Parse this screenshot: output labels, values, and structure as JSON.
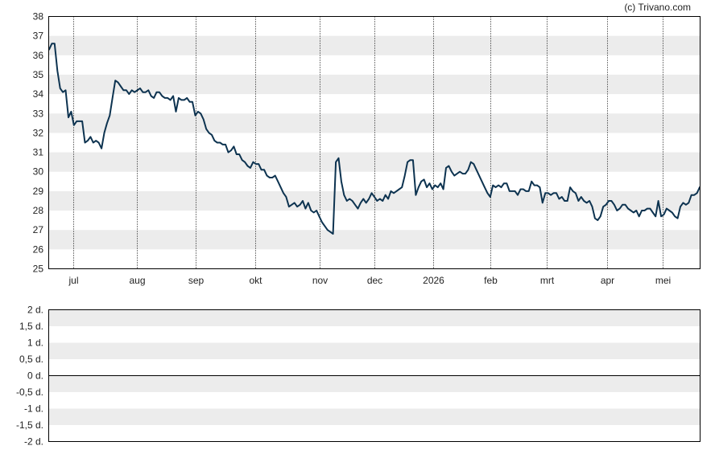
{
  "copyright": "(c) Trivano.com",
  "colors": {
    "line": "#0d3350",
    "band": "#ececec",
    "frame": "#000000"
  },
  "chart_data": [
    {
      "type": "line",
      "title": "",
      "xlabel": "",
      "ylabel": "",
      "ylim": [
        25,
        38
      ],
      "yticks": [
        "25",
        "26",
        "27",
        "28",
        "29",
        "30",
        "31",
        "32",
        "33",
        "34",
        "35",
        "36",
        "37",
        "38"
      ],
      "xticks": [
        "jul",
        "aug",
        "sep",
        "okt",
        "nov",
        "dec",
        "2026",
        "feb",
        "mrt",
        "apr",
        "mei"
      ],
      "grid": "horizontal bands + dotted vertical month lines",
      "series": [
        {
          "values": [
            36.3,
            36.6,
            36.6,
            35.2,
            34.3,
            34.1,
            34.2,
            32.8,
            33.1,
            32.4,
            32.6,
            32.6,
            32.6,
            31.5,
            31.6,
            31.8,
            31.5,
            31.6,
            31.5,
            31.2,
            32.0,
            32.5,
            32.9,
            33.8,
            34.7,
            34.6,
            34.4,
            34.2,
            34.2,
            34.0,
            34.2,
            34.1,
            34.2,
            34.3,
            34.1,
            34.1,
            34.2,
            33.9,
            33.8,
            34.1,
            34.1,
            33.9,
            33.8,
            33.8,
            33.7,
            33.9,
            33.1,
            33.8,
            33.7,
            33.7,
            33.8,
            33.6,
            33.6,
            32.9,
            33.1,
            33.0,
            32.7,
            32.2,
            32.0,
            31.9,
            31.6,
            31.5,
            31.5,
            31.4,
            31.4,
            31.0,
            31.1,
            31.3,
            30.9,
            30.9,
            30.6,
            30.5,
            30.3,
            30.2,
            30.5,
            30.4,
            30.4,
            30.1,
            30.1,
            29.8,
            29.7,
            29.7,
            29.8,
            29.5,
            29.2,
            28.9,
            28.7,
            28.2,
            28.3,
            28.4,
            28.2,
            28.3,
            28.5,
            28.1,
            28.4,
            28.0,
            27.9,
            28.0,
            27.7,
            27.4,
            27.2,
            27.0,
            26.9,
            26.8,
            30.5,
            30.7,
            29.5,
            28.8,
            28.5,
            28.6,
            28.5,
            28.3,
            28.1,
            28.4,
            28.6,
            28.4,
            28.6,
            28.9,
            28.7,
            28.5,
            28.6,
            28.5,
            28.8,
            28.6,
            29.0,
            28.9,
            29.0,
            29.1,
            29.2,
            29.8,
            30.5,
            30.6,
            30.6,
            28.8,
            29.2,
            29.5,
            29.6,
            29.2,
            29.4,
            29.1,
            29.3,
            29.2,
            29.4,
            29.1,
            30.2,
            30.3,
            30.0,
            29.8,
            29.9,
            30.0,
            29.9,
            29.9,
            30.1,
            30.5,
            30.4,
            30.1,
            29.8,
            29.5,
            29.2,
            28.9,
            28.7,
            29.3,
            29.2,
            29.3,
            29.2,
            29.4,
            29.4,
            29.0,
            29.0,
            29.0,
            28.8,
            29.1,
            29.1,
            29.0,
            29.0,
            29.5,
            29.3,
            29.3,
            29.2,
            28.4,
            28.9,
            28.9,
            28.8,
            28.9,
            28.9,
            28.6,
            28.7,
            28.5,
            28.5,
            29.2,
            29.0,
            28.9,
            28.5,
            28.7,
            28.5,
            28.4,
            28.5,
            28.2,
            27.6,
            27.5,
            27.7,
            28.2,
            28.3,
            28.5,
            28.5,
            28.3,
            28.0,
            28.1,
            28.3,
            28.3,
            28.1,
            28.0,
            27.9,
            28.0,
            27.7,
            28.0,
            28.0,
            28.1,
            28.1,
            27.9,
            27.7,
            28.5,
            27.7,
            27.8,
            28.1,
            28.0,
            27.9,
            27.7,
            27.6,
            28.2,
            28.4,
            28.3,
            28.4,
            28.8,
            28.8,
            28.9,
            29.2
          ]
        }
      ]
    },
    {
      "type": "line",
      "title": "",
      "xlabel": "",
      "ylabel": "",
      "ylim": [
        -2,
        2
      ],
      "yticks": [
        "2 d.",
        "1,5 d.",
        "1 d.",
        "0,5 d.",
        "0 d.",
        "-0,5 d.",
        "-1 d.",
        "-1,5 d.",
        "-2 d."
      ],
      "reference_line": 0,
      "series": []
    }
  ]
}
